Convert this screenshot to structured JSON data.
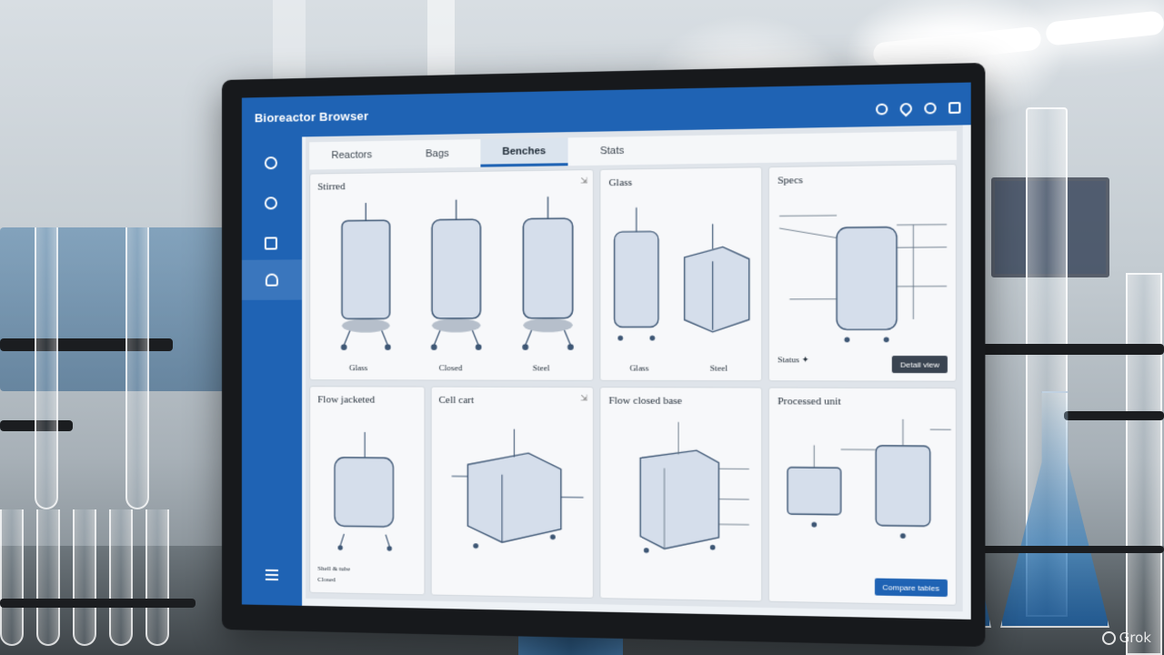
{
  "app": {
    "title": "Bioreactor Browser"
  },
  "colors": {
    "brand_blue": "#1f63b4",
    "sidebar": "#1f63b4",
    "active_tab": "#dbe4ee",
    "button_dark": "#3a4451"
  },
  "header_icons": [
    "settings-icon",
    "drop-icon",
    "notification-icon",
    "window-icon"
  ],
  "sidebar_icons": [
    "compass-icon",
    "gauge-icon",
    "image-icon",
    "user-icon",
    "menu-icon"
  ],
  "tabs": [
    {
      "label": "Reactors"
    },
    {
      "label": "Bags"
    },
    {
      "label": "Benches"
    },
    {
      "label": "Stats"
    }
  ],
  "cards": {
    "stirred": {
      "title": "Stirred",
      "corner": "⇲",
      "labels": [
        "Glass",
        "Closed",
        "Steel"
      ]
    },
    "glass": {
      "title": "Glass",
      "corner": "⇲",
      "labels": [
        "Glass",
        "Steel"
      ]
    },
    "specs": {
      "title": "Specs",
      "note": "Status ✦",
      "button": "Detail view"
    },
    "flow_jacketed": {
      "title": "Flow jacketed",
      "note": "Shell & tube",
      "note2": "Closed"
    },
    "cell_cart": {
      "title": "Cell cart",
      "corner": "⇲"
    },
    "flow_closed": {
      "title": "Flow closed base"
    },
    "processed": {
      "title": "Processed unit",
      "button": "Compare tables"
    }
  },
  "watermark": "Grok"
}
